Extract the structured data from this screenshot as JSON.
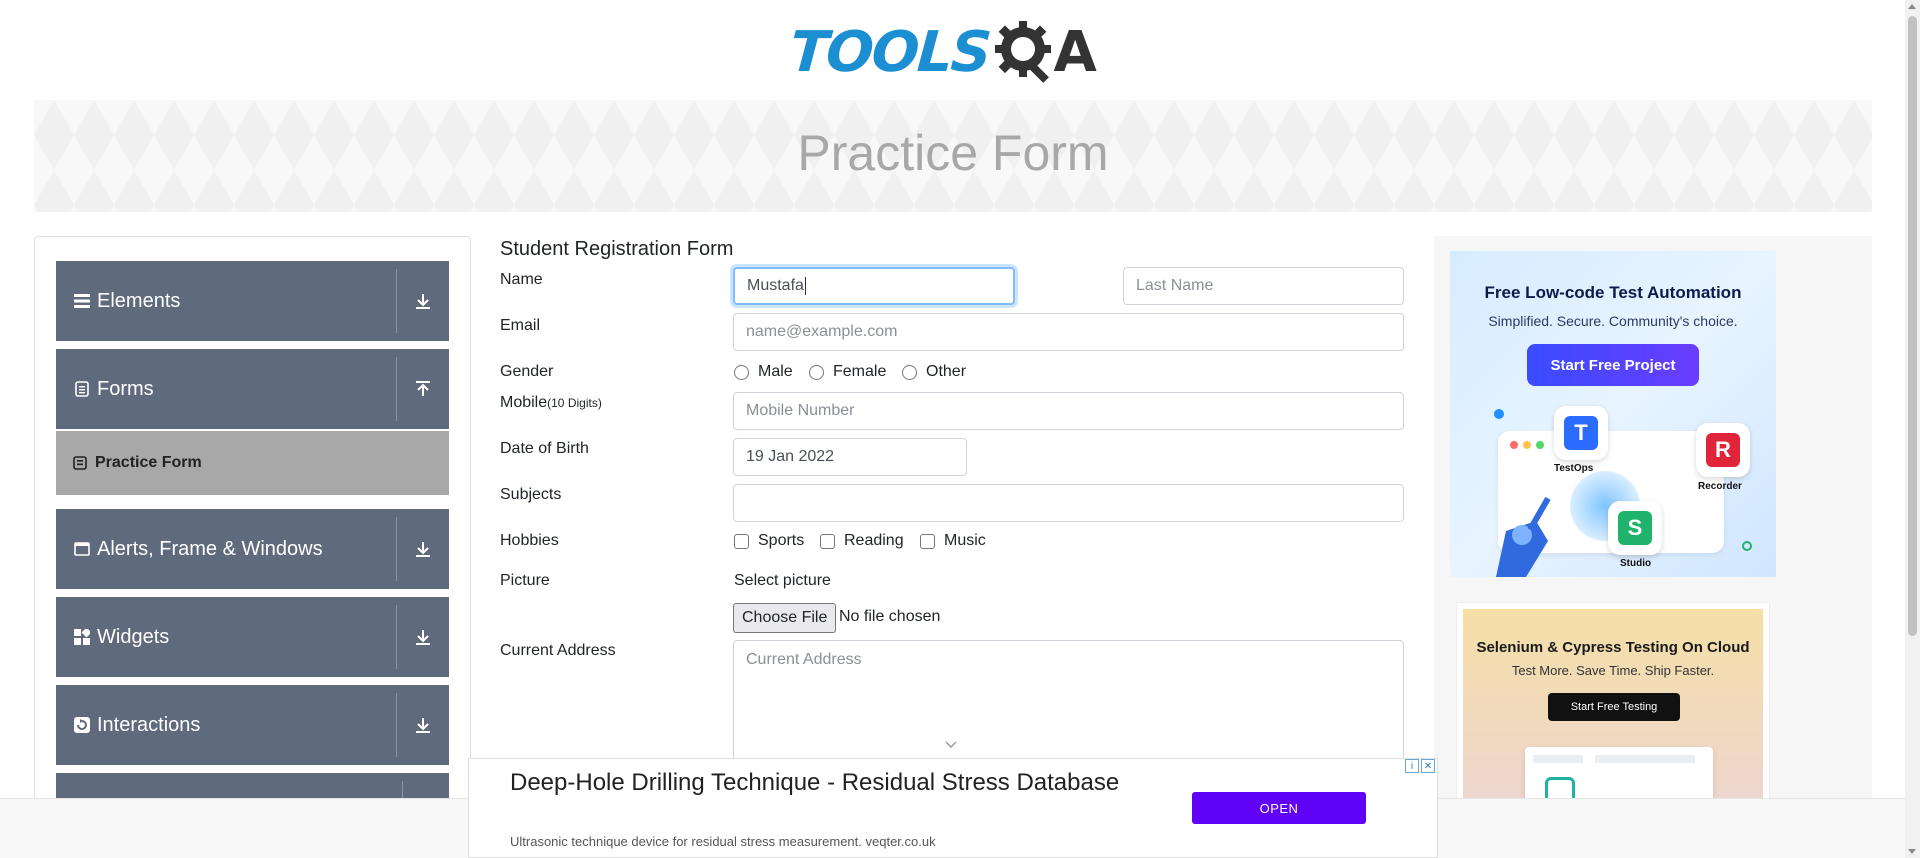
{
  "header": {
    "logo_text": "TOOLSQA",
    "logo_left": "TOOLS",
    "logo_right": "A",
    "page_title": "Practice Form"
  },
  "sidebar": {
    "groups": [
      {
        "label": "Elements",
        "icon": "list-icon",
        "arrow": "download-arrow-icon"
      },
      {
        "label": "Forms",
        "icon": "document-icon",
        "arrow": "upload-arrow-icon"
      },
      {
        "label": "Alerts, Frame & Windows",
        "icon": "window-icon",
        "arrow": "download-arrow-icon"
      },
      {
        "label": "Widgets",
        "icon": "widgets-icon",
        "arrow": "download-arrow-icon"
      },
      {
        "label": "Interactions",
        "icon": "interactions-icon",
        "arrow": "download-arrow-icon"
      }
    ],
    "active_subitem": {
      "label": "Practice Form",
      "icon": "form-icon"
    }
  },
  "form": {
    "title": "Student Registration Form",
    "labels": {
      "name": "Name",
      "email": "Email",
      "gender": "Gender",
      "mobile": "Mobile",
      "mobile_hint": "(10 Digits)",
      "dob": "Date of Birth",
      "subjects": "Subjects",
      "hobbies": "Hobbies",
      "picture": "Picture",
      "address": "Current Address"
    },
    "first_name_value": "Mustafa",
    "last_name_placeholder": "Last Name",
    "email_placeholder": "name@example.com",
    "gender_options": [
      "Male",
      "Female",
      "Other"
    ],
    "mobile_placeholder": "Mobile Number",
    "dob_value": "19 Jan 2022",
    "subjects_value": "",
    "hobbies_options": [
      "Sports",
      "Reading",
      "Music"
    ],
    "picture_caption": "Select picture",
    "choose_file_label": "Choose File",
    "file_status": "No file chosen",
    "address_placeholder": "Current Address"
  },
  "ads": {
    "ad1": {
      "title": "Free Low-code Test Automation",
      "subtitle": "Simplified. Secure. Community's choice.",
      "button": "Start Free Project",
      "products": [
        "TestOps",
        "Recorder",
        "Studio"
      ]
    },
    "ad2": {
      "title": "Selenium & Cypress Testing On Cloud",
      "subtitle": "Test More. Save Time. Ship Faster.",
      "button": "Start Free Testing"
    },
    "bottom": {
      "headline": "Deep-Hole Drilling Technique - Residual Stress Database",
      "sub": "Ultrasonic technique device for residual stress measurement. veqter.co.uk",
      "button": "OPEN"
    }
  },
  "colors": {
    "sidebar_group": "#5f6a7d",
    "sidebar_active": "#a8a8a8",
    "focus_border": "#80bdff",
    "logo_blue": "#1b8fd1",
    "ad_open_button": "#5f02f5"
  }
}
